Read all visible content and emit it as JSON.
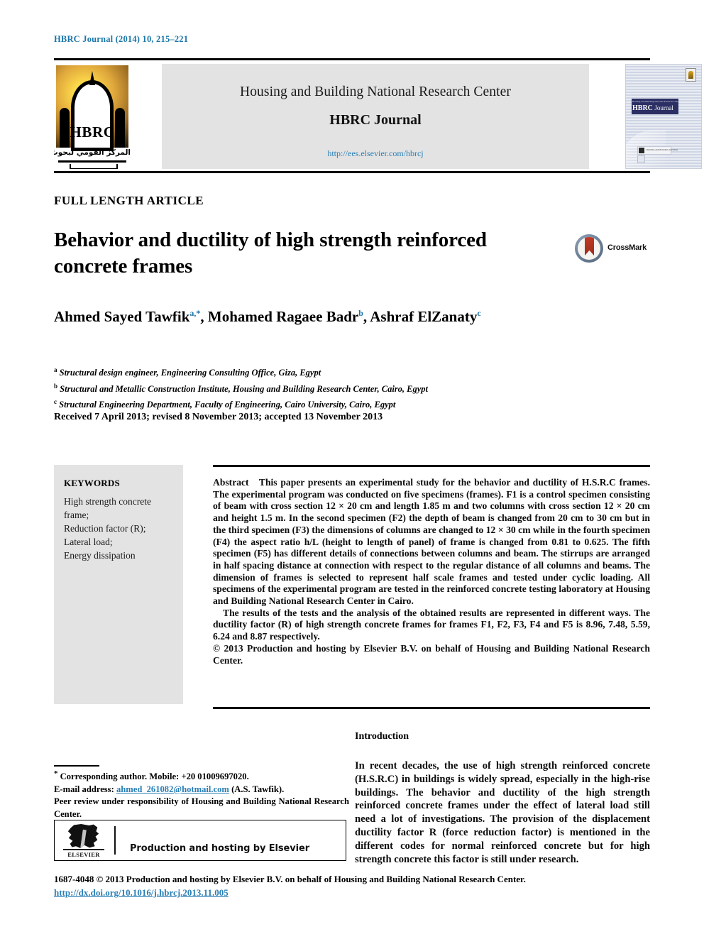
{
  "running_head": "HBRC Journal (2014) 10, 215–221",
  "masthead": {
    "logo": {
      "acronym": "HBRC",
      "arabic": "المركز القومي لبحوث الإسكان والبناء"
    },
    "center": {
      "organization": "Housing and Building National Research Center",
      "journal": "HBRC Journal",
      "url": "http://ees.elsevier.com/hbrcj"
    },
    "cover": {
      "subtitle": "Housing and Building National Research Center",
      "title_bold": "HBRC",
      "title_light": "Journal",
      "caption": "HOUSING AND BUILDING NATIONAL"
    }
  },
  "article": {
    "kicker": "FULL LENGTH ARTICLE",
    "title": "Behavior and ductility of high strength reinforced concrete frames",
    "crossmark_label": "CrossMark",
    "authors": [
      {
        "name": "Ahmed Sayed Tawfik",
        "marks": "a,*"
      },
      {
        "name": "Mohamed Ragaee Badr",
        "marks": "b"
      },
      {
        "name": "Ashraf ElZanaty",
        "marks": "c"
      }
    ],
    "affiliations": [
      {
        "mark": "a",
        "text": "Structural design engineer, Engineering Consulting Office, Giza, Egypt"
      },
      {
        "mark": "b",
        "text": "Structural and Metallic Construction Institute, Housing and Building Research Center, Cairo, Egypt"
      },
      {
        "mark": "c",
        "text": "Structural Engineering Department, Faculty of Engineering, Cairo University, Cairo, Egypt"
      }
    ],
    "history": "Received 7 April 2013; revised 8 November 2013; accepted 13 November 2013"
  },
  "keywords": {
    "heading": "KEYWORDS",
    "items": [
      "High strength concrete frame;",
      "Reduction factor (R);",
      "Lateral load;",
      "Energy dissipation"
    ]
  },
  "abstract": {
    "label": "Abstract",
    "paragraph1": "This paper presents an experimental study for the behavior and ductility of H.S.R.C frames. The experimental program was conducted on five specimens (frames). F1 is a control specimen consisting of beam with cross section 12 × 20 cm and length 1.85 m and two columns with cross section 12 × 20 cm and height 1.5 m. In the second specimen (F2) the depth of beam is changed from 20 cm to 30 cm but in the third specimen (F3) the dimensions of columns are changed to 12 × 30 cm while in the fourth specimen (F4) the aspect ratio h/L (height to length of panel) of frame is changed from 0.81 to 0.625. The fifth specimen (F5) has different details of connections between columns and beam. The stirrups are arranged in half spacing distance at connection with respect to the regular distance of all columns and beams. The dimension of frames is selected to represent half scale frames and tested under cyclic loading. All specimens of the experimental program are tested in the reinforced concrete testing laboratory at Housing and Building National Research Center in Cairo.",
    "paragraph2": "The results of the tests and the analysis of the obtained results are represented in different ways. The ductility factor (R) of high strength concrete frames for frames F1, F2, F3, F4 and F5 is 8.96, 7.48, 5.59, 6.24 and 8.87 respectively.",
    "rights": "© 2013 Production and hosting by Elsevier B.V. on behalf of Housing and Building National Research Center."
  },
  "introduction": {
    "heading": "Introduction",
    "body": "In recent decades, the use of high strength reinforced concrete (H.S.R.C) in buildings is widely spread, especially in the high-rise buildings. The behavior and ductility of the high strength reinforced concrete frames under the effect of lateral load still need a lot of investigations. The provision of the displacement ductility factor R (force reduction factor) is mentioned in the different codes for normal reinforced concrete but for high strength concrete this factor is still under research."
  },
  "footnote": {
    "corresponding": "Corresponding author. Mobile: +20 01009697020.",
    "email_label": "E-mail address:",
    "email": "ahmed_261082@hotmail.com",
    "email_suffix": "(A.S. Tawfik).",
    "peer_review": "Peer review under responsibility of Housing and Building National Research Center."
  },
  "elsevier_box": {
    "logo_word": "ELSEVIER",
    "text": "Production and hosting by Elsevier"
  },
  "bottom": {
    "copyright": "1687-4048 © 2013 Production and hosting by Elsevier B.V. on behalf of Housing and Building National Research Center.",
    "doi": "http://dx.doi.org/10.1016/j.hbrcj.2013.11.005"
  },
  "colors": {
    "link": "#2a7fb5",
    "running_head": "#1a76a8",
    "panel_gray": "#e3e3e3",
    "crossmark_red": "#c03a25",
    "cover_navy": "#2b2f63"
  }
}
